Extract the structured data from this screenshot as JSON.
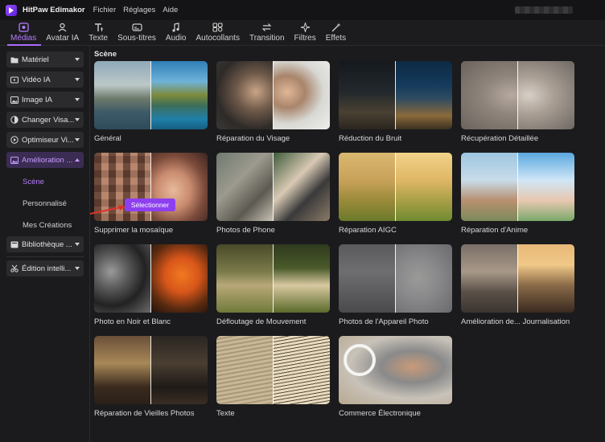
{
  "app": {
    "name": "HitPaw Edimakor"
  },
  "menu": [
    "Fichier",
    "Réglages",
    "Aide"
  ],
  "toolbar": {
    "tabs": [
      {
        "label": "Médias",
        "icon": "media-icon",
        "active": true
      },
      {
        "label": "Avatar IA",
        "icon": "avatar-icon",
        "active": false
      },
      {
        "label": "Texte",
        "icon": "text-icon",
        "active": false
      },
      {
        "label": "Sous-titres",
        "icon": "subtitles-icon",
        "active": false
      },
      {
        "label": "Audio",
        "icon": "music-note-icon",
        "active": false
      },
      {
        "label": "Autocollants",
        "icon": "stickers-icon",
        "active": false
      },
      {
        "label": "Transition",
        "icon": "transition-icon",
        "active": false
      },
      {
        "label": "Filtres",
        "icon": "sparkle-icon",
        "active": false
      },
      {
        "label": "Effets",
        "icon": "effects-icon",
        "active": false
      }
    ]
  },
  "sidebar": {
    "items": [
      {
        "label": "Matériel",
        "icon": "folder-icon"
      },
      {
        "label": "Vidéo IA",
        "icon": "video-icon"
      },
      {
        "label": "Image IA",
        "icon": "image-icon"
      },
      {
        "label": "Changer Visa...",
        "icon": "face-swap-icon"
      },
      {
        "label": "Optimiseur Vi...",
        "icon": "optimizer-icon"
      },
      {
        "label": "Amélioration ...",
        "icon": "enhance-icon",
        "open": true
      },
      {
        "label": "Bibliothèque ...",
        "icon": "library-icon"
      },
      {
        "label": "Édition intelli...",
        "icon": "scissors-icon"
      }
    ],
    "subitems": [
      {
        "label": "Scène",
        "active": true
      },
      {
        "label": "Personnalisé",
        "active": false
      },
      {
        "label": "Mes Créations",
        "active": false
      }
    ]
  },
  "main": {
    "section_title": "Scène",
    "select_label": "Sélectionner",
    "cards": [
      {
        "label": "Général"
      },
      {
        "label": "Réparation du Visage"
      },
      {
        "label": "Réduction du Bruit"
      },
      {
        "label": "Récupération Détaillée"
      },
      {
        "label": "Supprimer la mosaïque"
      },
      {
        "label": "Photos de Phone"
      },
      {
        "label": "Réparation AIGC"
      },
      {
        "label": "Réparation d'Anime"
      },
      {
        "label": "Photo en Noir et Blanc"
      },
      {
        "label": "Défloutage de Mouvement"
      },
      {
        "label": "Photos de l'Appareil Photo"
      },
      {
        "label": "Amélioration de... Journalisation"
      },
      {
        "label": "Réparation de Vieilles Photos"
      },
      {
        "label": "Texte"
      },
      {
        "label": "Commerce Électronique"
      }
    ]
  },
  "colors": {
    "accent": "#a96bff",
    "button": "#8d3ff0",
    "background": "#1b1b1d"
  }
}
